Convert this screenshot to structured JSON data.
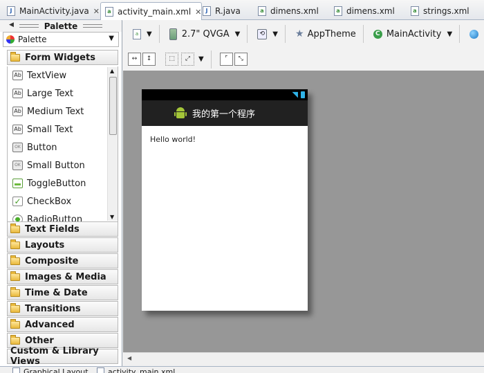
{
  "editor_tabs": [
    {
      "label": "MainActivity.java",
      "type": "java",
      "closable": true,
      "active": false
    },
    {
      "label": "activity_main.xml",
      "type": "xml",
      "closable": true,
      "active": true
    },
    {
      "label": "R.java",
      "type": "java",
      "closable": false,
      "active": false
    },
    {
      "label": "dimens.xml",
      "type": "xml",
      "closable": false,
      "active": false
    },
    {
      "label": "dimens.xml",
      "type": "xml",
      "closable": false,
      "active": false
    },
    {
      "label": "strings.xml",
      "type": "xml",
      "closable": false,
      "active": false
    }
  ],
  "palette": {
    "title": "Palette",
    "selector": "Palette",
    "open_category": "Form Widgets",
    "widgets": [
      "TextView",
      "Large Text",
      "Medium Text",
      "Small Text",
      "Button",
      "Small Button",
      "ToggleButton",
      "CheckBox",
      "RadioButton"
    ],
    "widget_icons": [
      "Ab",
      "Ab",
      "Ab",
      "Ab",
      "OK",
      "OK",
      "toggle",
      "check",
      "radio"
    ],
    "categories": [
      "Text Fields",
      "Layouts",
      "Composite",
      "Images & Media",
      "Time & Date",
      "Transitions",
      "Advanced",
      "Other"
    ],
    "custom": "Custom & Library Views"
  },
  "toolbar": {
    "device": "2.7\" QVGA",
    "theme": "AppTheme",
    "activity": "MainActivity"
  },
  "device_preview": {
    "app_title": "我的第一个程序",
    "content_text": "Hello world!",
    "accent_color": "#212121",
    "status_icon_color": "#2fb3e8"
  },
  "bottom_tabs": [
    "Graphical Layout",
    "activity_main.xml"
  ]
}
